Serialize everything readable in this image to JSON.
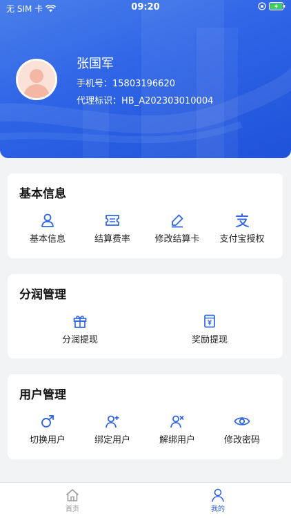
{
  "status_bar": {
    "carrier": "无 SIM 卡",
    "time": "09:20"
  },
  "profile": {
    "name": "张国军",
    "phone_label": "手机号：",
    "phone": "15803196620",
    "agent_label": "代理标识：",
    "agent_id": "HB_A202303010004"
  },
  "sections": {
    "basic": {
      "title": "基本信息",
      "items": [
        {
          "label": "基本信息",
          "icon": "user-icon"
        },
        {
          "label": "结算费率",
          "icon": "ticket-icon"
        },
        {
          "label": "修改结算卡",
          "icon": "edit-pen-icon"
        },
        {
          "label": "支付宝授权",
          "icon": "alipay-icon"
        }
      ]
    },
    "profit": {
      "title": "分润管理",
      "items": [
        {
          "label": "分润提现",
          "icon": "gift-icon"
        },
        {
          "label": "奖励提现",
          "icon": "yen-cash-icon"
        }
      ]
    },
    "users": {
      "title": "用户管理",
      "items": [
        {
          "label": "切换用户",
          "icon": "male-symbol-icon"
        },
        {
          "label": "绑定用户",
          "icon": "user-plus-icon"
        },
        {
          "label": "解绑用户",
          "icon": "user-remove-icon"
        },
        {
          "label": "修改密码",
          "icon": "eye-icon"
        }
      ]
    }
  },
  "tabbar": {
    "home": "首页",
    "mine": "我的"
  },
  "colors": {
    "accent": "#2e64e6",
    "header_gradient_start": "#4a7fea",
    "header_gradient_end": "#1f52d9",
    "tab_inactive": "#999999",
    "page_bg": "#f2f3f5"
  }
}
